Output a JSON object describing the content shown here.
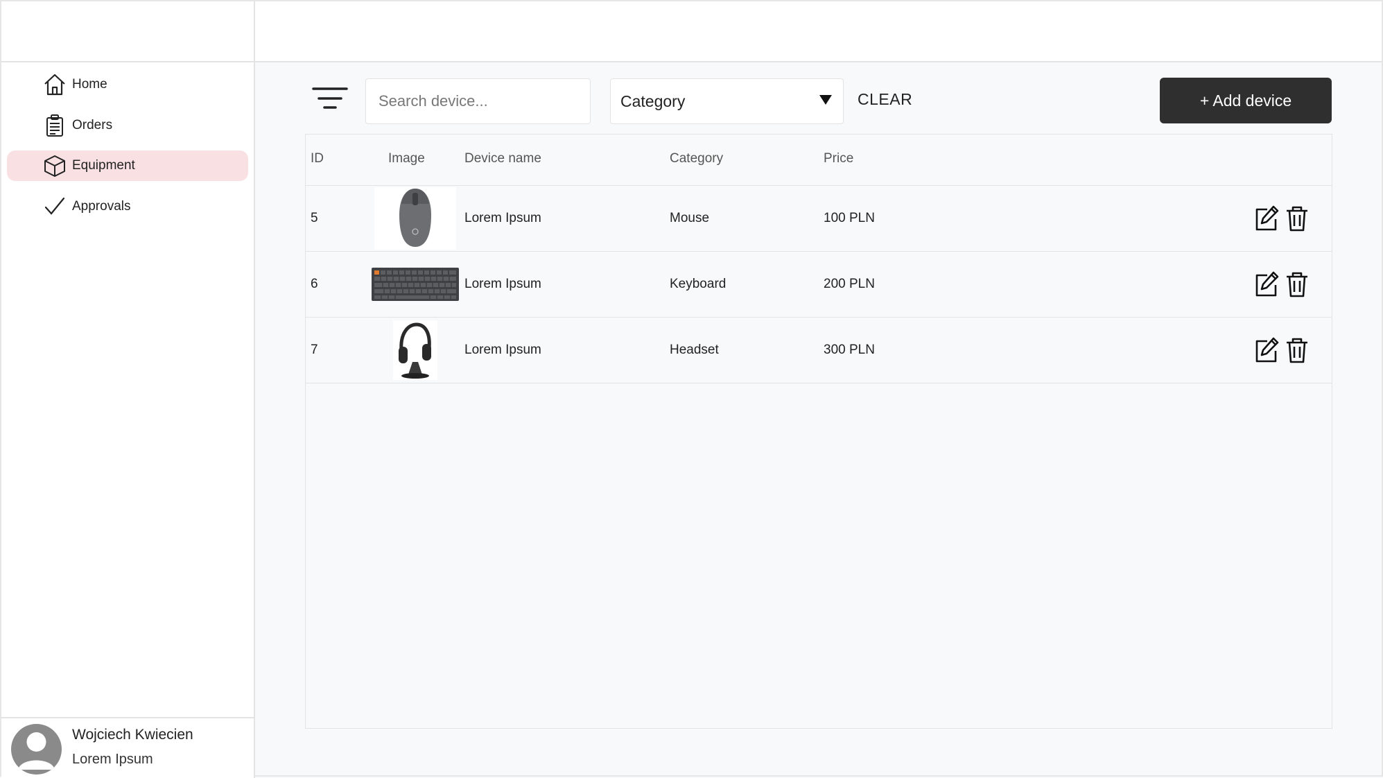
{
  "sidebar": {
    "items": [
      {
        "label": "Home",
        "icon": "home-icon"
      },
      {
        "label": "Orders",
        "icon": "clipboard-icon"
      },
      {
        "label": "Equipment",
        "icon": "box-icon",
        "active": true
      },
      {
        "label": "Approvals",
        "icon": "check-icon"
      }
    ],
    "user": {
      "name": "Wojciech Kwiecien",
      "subtitle": "Lorem Ipsum"
    }
  },
  "toolbar": {
    "search_placeholder": "Search device...",
    "category_label": "Category",
    "clear_label": "CLEAR",
    "add_label": "+ Add device"
  },
  "table": {
    "headers": [
      "ID",
      "Image",
      "Device name",
      "Category",
      "Price"
    ],
    "rows": [
      {
        "id": "5",
        "image": "mouse",
        "name": "Lorem Ipsum",
        "category": "Mouse",
        "price": "100 PLN"
      },
      {
        "id": "6",
        "image": "keyboard",
        "name": "Lorem Ipsum",
        "category": "Keyboard",
        "price": "200 PLN"
      },
      {
        "id": "7",
        "image": "headset",
        "name": "Lorem Ipsum",
        "category": "Headset",
        "price": "300 PLN"
      }
    ]
  },
  "colors": {
    "active_nav": "#f9e0e3",
    "primary_button": "#2f2f2f",
    "background": "#f8f9fa"
  }
}
